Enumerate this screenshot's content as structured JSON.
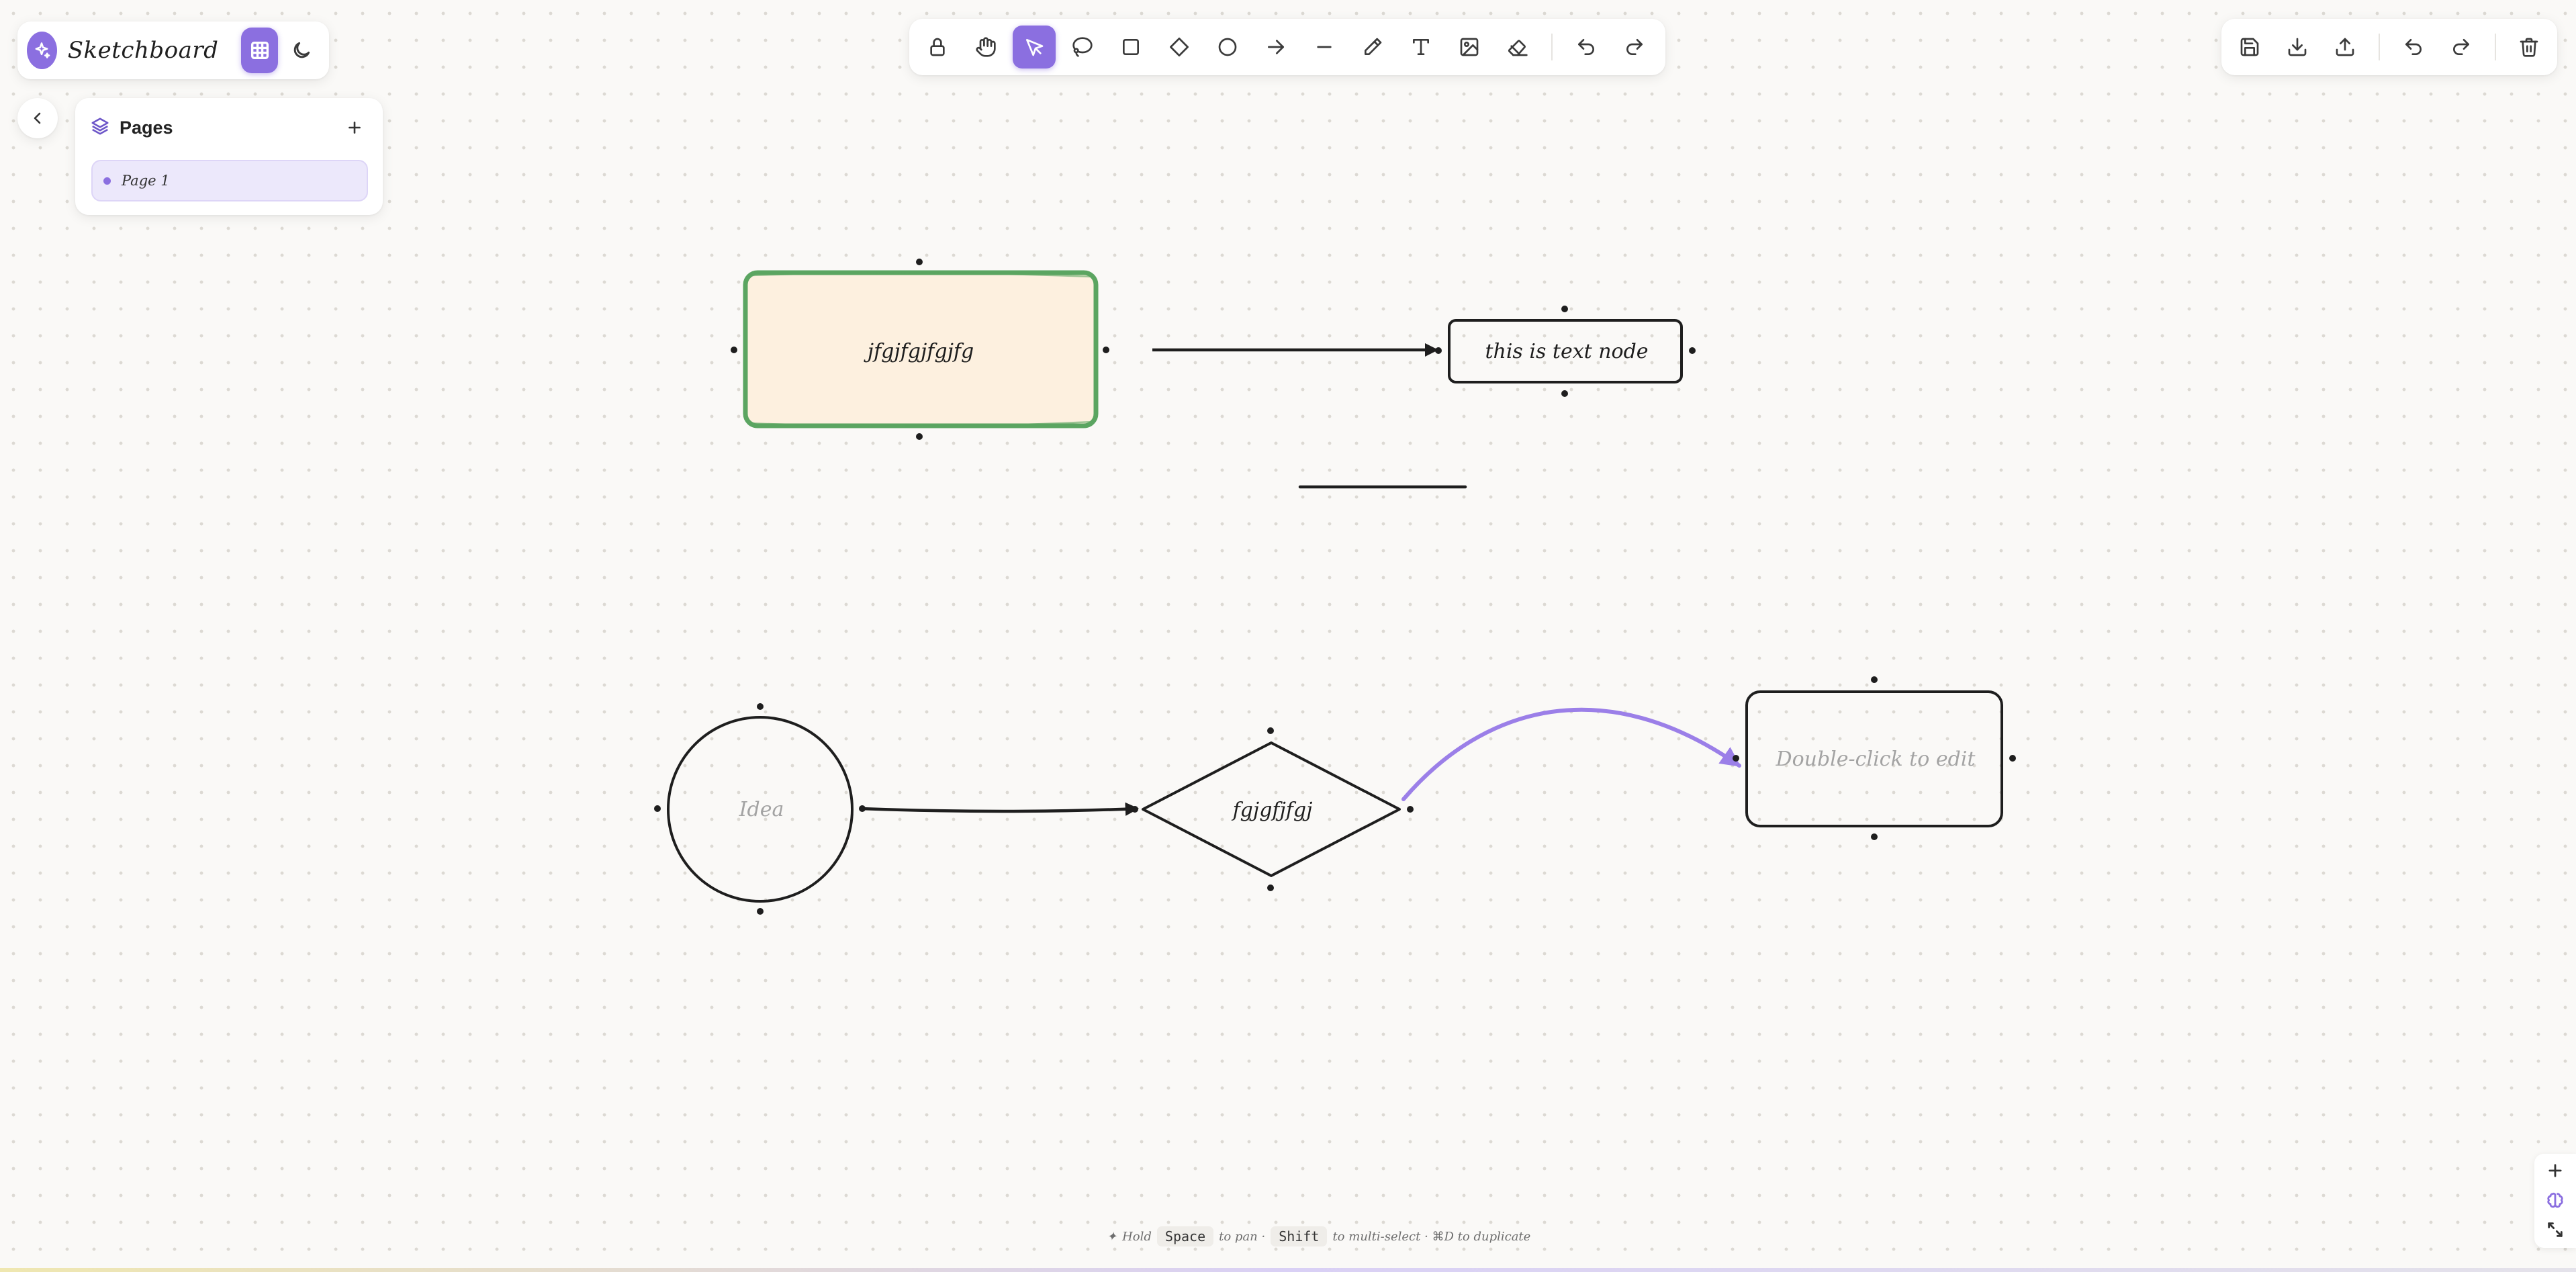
{
  "app": {
    "name": "Sketchboard"
  },
  "brand_controls": {
    "grid_icon": "grid-icon",
    "theme_icon": "moon-icon"
  },
  "pages_panel": {
    "title": "Pages",
    "add_icon": "plus-icon",
    "items": [
      {
        "label": "Page 1",
        "active": true
      }
    ]
  },
  "toolbar": {
    "tools": [
      "lock",
      "hand",
      "select",
      "lasso",
      "rectangle",
      "diamond",
      "ellipse",
      "arrow",
      "line",
      "pencil",
      "text",
      "image",
      "eraser",
      "undo",
      "redo"
    ],
    "active_tool": "select"
  },
  "actions": [
    "save",
    "download",
    "upload",
    "undo",
    "redo",
    "delete"
  ],
  "canvas": {
    "nodes": {
      "rect_node": {
        "text": "jfgjfgjfgjfg",
        "fill": "#fdf0df",
        "stroke": "#5ba561"
      },
      "text_node": {
        "text": "this is text node"
      },
      "circle_node": {
        "text": "Idea"
      },
      "diamond_node": {
        "text": "fgjgfjfgj"
      },
      "rounded_node": {
        "text": "Double-click to edit"
      }
    },
    "curved_arrow_color": "#9b7fe8"
  },
  "hint": {
    "lead": "Hold",
    "key1": "Space",
    "mid": "to pan ·",
    "key2": "Shift",
    "tail": "to multi-select · ⌘D to duplicate"
  },
  "colors": {
    "accent": "#8b6fe0",
    "background": "#faf9f7"
  }
}
